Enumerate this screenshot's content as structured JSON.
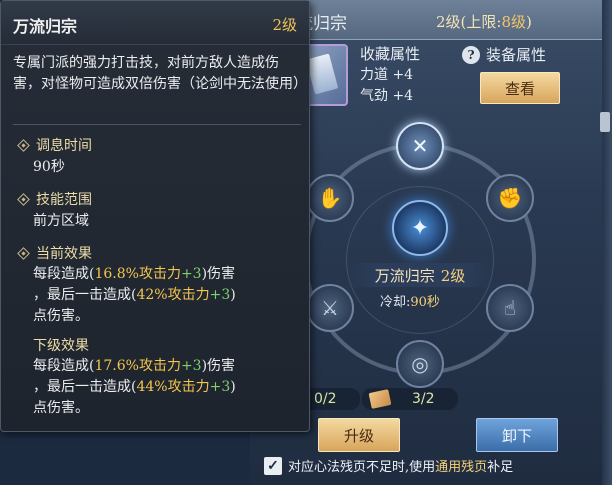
{
  "background": {
    "title": "流归宗",
    "level_prefix": "2级(上限:",
    "level_limit": "8级",
    "level_suffix": ")",
    "collect_title": "收藏属性",
    "collect_lines": [
      "力道 +4",
      "气劲 +4"
    ],
    "equip_label": "装备属性",
    "view_button": "查看",
    "skill_name": "万流归宗",
    "skill_level": "2级",
    "cooldown_label": "冷却:",
    "cooldown_value": "90秒",
    "counter_left": "0/2",
    "counter_right": "3/2",
    "upgrade_button": "升级",
    "unload_button": "卸下",
    "check_text_1": "对应心法残页不足时,使用",
    "check_text_hl": "通用残页",
    "check_text_2": "补足"
  },
  "tooltip": {
    "title": "万流归宗",
    "level": "2级",
    "description": "专属门派的强力打击技，对前方敌人造成伤害，对怪物可造成双倍伤害（论剑中无法使用）",
    "cooldown_label": "调息时间",
    "cooldown_value": "90秒",
    "range_label": "技能范围",
    "range_value": "前方区域",
    "current_label": "当前效果",
    "current_line1_a": "每段造成(",
    "current_line1_y": "16.8%攻击力",
    "current_line1_g": "+3",
    "current_line1_b": ")伤害",
    "current_line2_a": "，最后一击造成(",
    "current_line2_y": "42%攻击力",
    "current_line2_g": "+3",
    "current_line2_b": ")",
    "current_line3": "点伤害。",
    "next_label": "下级效果",
    "next_line1_a": "每段造成(",
    "next_line1_y": "17.6%攻击力",
    "next_line1_g": "+3",
    "next_line1_b": ")伤害",
    "next_line2_a": "，最后一击造成(",
    "next_line2_y": "44%攻击力",
    "next_line2_g": "+3",
    "next_line2_b": ")",
    "next_line3": "点伤害。"
  },
  "icons": {
    "node_top": "crossed-blades-icon",
    "node_left_upper": "palm-icon",
    "node_right_upper": "fist-icon",
    "node_left_lower": "sword-icon",
    "node_right_lower": "finger-icon",
    "node_bottom": "whirl-icon",
    "center": "figure-dash-icon"
  }
}
